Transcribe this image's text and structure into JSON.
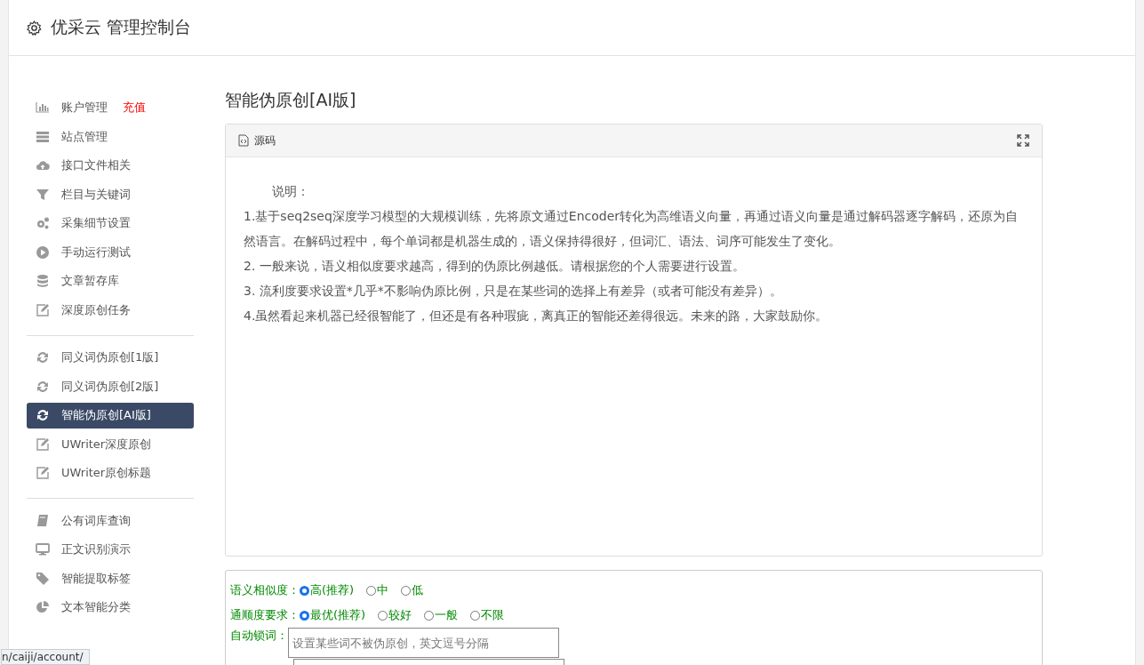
{
  "header": {
    "title": "优采云 管理控制台"
  },
  "sidebar": {
    "groups": [
      {
        "items": [
          {
            "label": "账户管理",
            "badge": "充值",
            "selected": false
          },
          {
            "label": "站点管理",
            "selected": false
          },
          {
            "label": "接口文件相关",
            "selected": false
          },
          {
            "label": "栏目与关键词",
            "selected": false
          },
          {
            "label": "采集细节设置",
            "selected": false
          },
          {
            "label": "手动运行测试",
            "selected": false
          },
          {
            "label": "文章暂存库",
            "selected": false
          },
          {
            "label": "深度原创任务",
            "selected": false
          }
        ]
      },
      {
        "items": [
          {
            "label": "同义词伪原创[1版]",
            "selected": false
          },
          {
            "label": "同义词伪原创[2版]",
            "selected": false
          },
          {
            "label": "智能伪原创[AI版]",
            "selected": true
          },
          {
            "label": "UWriter深度原创",
            "selected": false
          },
          {
            "label": "UWriter原创标题",
            "selected": false
          }
        ]
      },
      {
        "items": [
          {
            "label": "公有词库查询",
            "selected": false
          },
          {
            "label": "正文识别演示",
            "selected": false
          },
          {
            "label": "智能提取标签",
            "selected": false
          },
          {
            "label": "文本智能分类",
            "selected": false
          }
        ]
      }
    ]
  },
  "page": {
    "title": "智能伪原创[AI版]",
    "editor": {
      "toolbar_label": "源码",
      "paragraphs": [
        "说明：",
        "1.基于seq2seq深度学习模型的大规模训练，先将原文通过Encoder转化为高维语义向量，再通过语义向量是通过解码器逐字解码，还原为自然语言。在解码过程中，每个单词都是机器生成的，语义保持得很好，但词汇、语法、词序可能发生了变化。",
        "2. 一般来说，语义相似度要求越高，得到的伪原比例越低。请根据您的个人需要进行设置。",
        "3. 流利度要求设置*几乎*不影响伪原比例，只是在某些词的选择上有差异（或者可能没有差异）。",
        "4.虽然看起来机器已经很智能了，但还是有各种瑕疵，离真正的智能还差得很远。未来的路，大家鼓励你。"
      ]
    },
    "options": [
      {
        "label": "语义相似度：",
        "choices": [
          {
            "label": "高(推荐)",
            "selected": true
          },
          {
            "label": "中",
            "selected": false
          },
          {
            "label": "低",
            "selected": false
          }
        ]
      },
      {
        "label": "通顺度要求：",
        "choices": [
          {
            "label": "最优(推荐)",
            "selected": true
          },
          {
            "label": "较好",
            "selected": false
          },
          {
            "label": "一般",
            "selected": false
          },
          {
            "label": "不限",
            "selected": false
          }
        ]
      }
    ],
    "lock_words": {
      "label": "自动锁词：",
      "placeholder": "设置某些词不被伪原创，英文逗号分隔"
    }
  },
  "status_url": "n/caiji/account/"
}
